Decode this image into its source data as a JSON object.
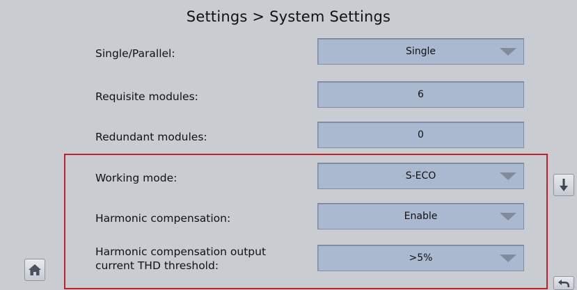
{
  "header": {
    "title": "Settings > System Settings"
  },
  "rows": [
    {
      "label": "Single/Parallel:",
      "value": "Single",
      "dropdown": true
    },
    {
      "label": "Requisite modules:",
      "value": "6",
      "dropdown": false
    },
    {
      "label": "Redundant modules:",
      "value": "0",
      "dropdown": false
    },
    {
      "label": "Working mode:",
      "value": "S-ECO",
      "dropdown": true
    },
    {
      "label": "Harmonic compensation:",
      "value": "Enable",
      "dropdown": true
    },
    {
      "label_line1": "Harmonic compensation output",
      "label_line2": "current THD threshold:",
      "value": ">5%",
      "dropdown": true
    }
  ],
  "icons": {
    "home": "home-icon",
    "scroll_down": "arrow-down-icon",
    "back": "back-arrow-icon"
  },
  "colors": {
    "background": "#c9ccd1",
    "field": "#aab9cf",
    "highlight_border": "#c0202a"
  }
}
